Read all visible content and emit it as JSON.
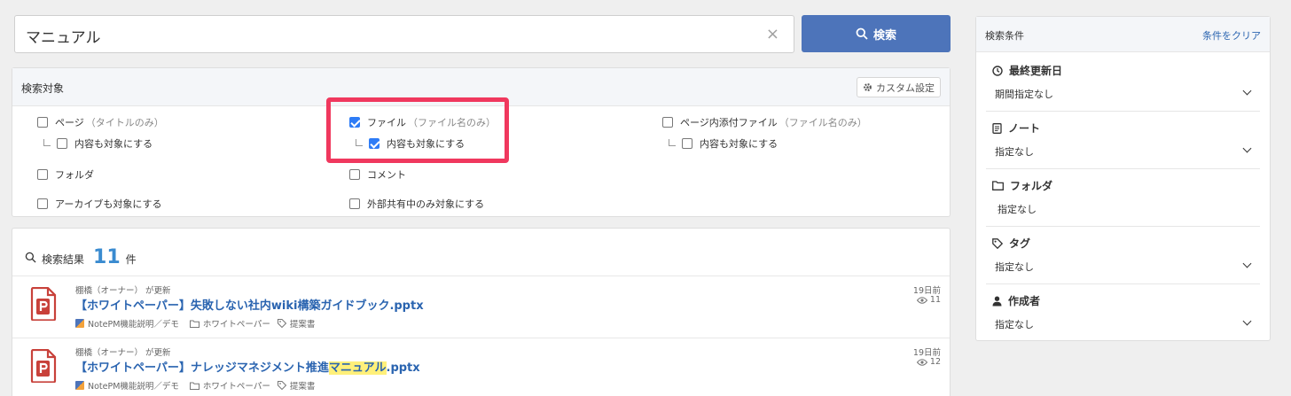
{
  "search": {
    "value": "マニュアル",
    "clear_icon": "×",
    "button_label": "検索"
  },
  "target": {
    "title": "検索対象",
    "custom_label": "カスタム設定",
    "options": {
      "page": {
        "label": "ページ",
        "sub": "（タイトルのみ）",
        "checked": false
      },
      "page_content": {
        "label": "内容も対象にする",
        "checked": false
      },
      "file": {
        "label": "ファイル",
        "sub": "（ファイル名のみ）",
        "checked": true
      },
      "file_content": {
        "label": "内容も対象にする",
        "checked": true
      },
      "page_attach": {
        "label": "ページ内添付ファイル",
        "sub": "（ファイル名のみ）",
        "checked": false
      },
      "page_attach_content": {
        "label": "内容も対象にする",
        "checked": false
      },
      "folder": {
        "label": "フォルダ",
        "checked": false
      },
      "comment": {
        "label": "コメント",
        "checked": false
      },
      "archive": {
        "label": "アーカイブも対象にする",
        "checked": false
      },
      "external": {
        "label": "外部共有中のみ対象にする",
        "checked": false
      }
    }
  },
  "results": {
    "label": "検索結果",
    "count": "11",
    "unit": "件",
    "items": [
      {
        "meta": "棚橋（オーナー） が更新",
        "title_pre": "【ホワイトペーパー】失敗しない社内wiki構築ガイドブック.pptx",
        "title_hl": "",
        "title_post": "",
        "note": "NotePM機能説明／デモ",
        "folder": "ホワイトペーパー",
        "tag": "提案書",
        "time": "19日前",
        "views": "11"
      },
      {
        "meta": "棚橋（オーナー） が更新",
        "title_pre": "【ホワイトペーパー】ナレッジマネジメント推進",
        "title_hl": "マニュアル",
        "title_post": ".pptx",
        "note": "NotePM機能説明／デモ",
        "folder": "ホワイトペーパー",
        "tag": "提案書",
        "time": "19日前",
        "views": "12"
      }
    ]
  },
  "conditions": {
    "title": "検索条件",
    "clear_label": "条件をクリア",
    "sections": [
      {
        "label": "最終更新日",
        "icon": "clock-icon",
        "value": "期間指定なし",
        "dropdown": true
      },
      {
        "label": "ノート",
        "icon": "note-icon",
        "value": "指定なし",
        "dropdown": true
      },
      {
        "label": "フォルダ",
        "icon": "folder-icon",
        "value": "指定なし",
        "dropdown": false
      },
      {
        "label": "タグ",
        "icon": "tag-icon",
        "value": "指定なし",
        "dropdown": true
      },
      {
        "label": "作成者",
        "icon": "person-icon",
        "value": "指定なし",
        "dropdown": true
      }
    ]
  },
  "colors": {
    "primary": "#4d74ba",
    "link": "#2a64b0",
    "highlight_frame": "#f0385e",
    "count": "#3a8bd0",
    "checkbox": "#2e7cf6"
  }
}
